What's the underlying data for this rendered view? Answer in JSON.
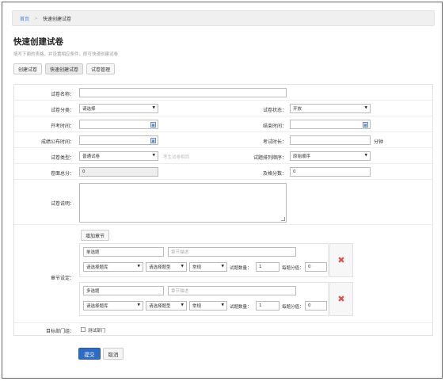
{
  "breadcrumb": {
    "home": "首页",
    "separator": ">",
    "current": "快速创建试卷"
  },
  "page": {
    "title": "快速创建试卷",
    "subtitle": "填写下面的表格，并设置相应条件，即可快速创建试卷"
  },
  "tabs": [
    "创建试卷",
    "快速创建试卷",
    "试卷管理"
  ],
  "form": {
    "paper_name": {
      "label": "试卷名称：",
      "value": ""
    },
    "category": {
      "label": "试卷分类：",
      "value": "请选择"
    },
    "status": {
      "label": "试卷状态：",
      "value": "开放"
    },
    "start_time": {
      "label": "开考时间：",
      "value": ""
    },
    "end_time": {
      "label": "结束时间：",
      "value": ""
    },
    "publish_time": {
      "label": "成绩公布时间：",
      "value": ""
    },
    "duration": {
      "label": "考试时长：",
      "value": "",
      "unit": "分钟"
    },
    "type": {
      "label": "试卷类型：",
      "value": "普通试卷",
      "hint": "考生试卷相同"
    },
    "order": {
      "label": "试题排列顺序：",
      "value": "原始顺序"
    },
    "total_score": {
      "label": "卷面总分：",
      "value": "0"
    },
    "pass_score": {
      "label": "及格分数：",
      "value": "0"
    },
    "description": {
      "label": "试卷说明：",
      "value": ""
    },
    "chapter": {
      "label": "章节设定：",
      "add_button": "增加章节",
      "sections": [
        {
          "name": "单选题",
          "desc_placeholder": "章节描述",
          "bank": "请选择题库",
          "qtype": "请选择题型",
          "level": "常规",
          "count_label": "试题数量：",
          "count": "1",
          "score_label": "每题分值：",
          "score": "0"
        },
        {
          "name": "多选题",
          "desc_placeholder": "章节描述",
          "bank": "请选择题库",
          "qtype": "请选择题型",
          "level": "常规",
          "count_label": "试题数量：",
          "count": "1",
          "score_label": "每题分值：",
          "score": "0"
        }
      ]
    },
    "target_dept": {
      "label": "目标部门组：",
      "option": "测试部门"
    }
  },
  "actions": {
    "submit": "提交",
    "cancel": "取消"
  },
  "icons": {
    "calendar": "calendar-icon",
    "delete": "close-icon",
    "dropdown": "chevron-down-icon"
  },
  "colors": {
    "accent": "#2f6bc1",
    "delete": "#d9534f",
    "link": "#3a7bd5"
  }
}
